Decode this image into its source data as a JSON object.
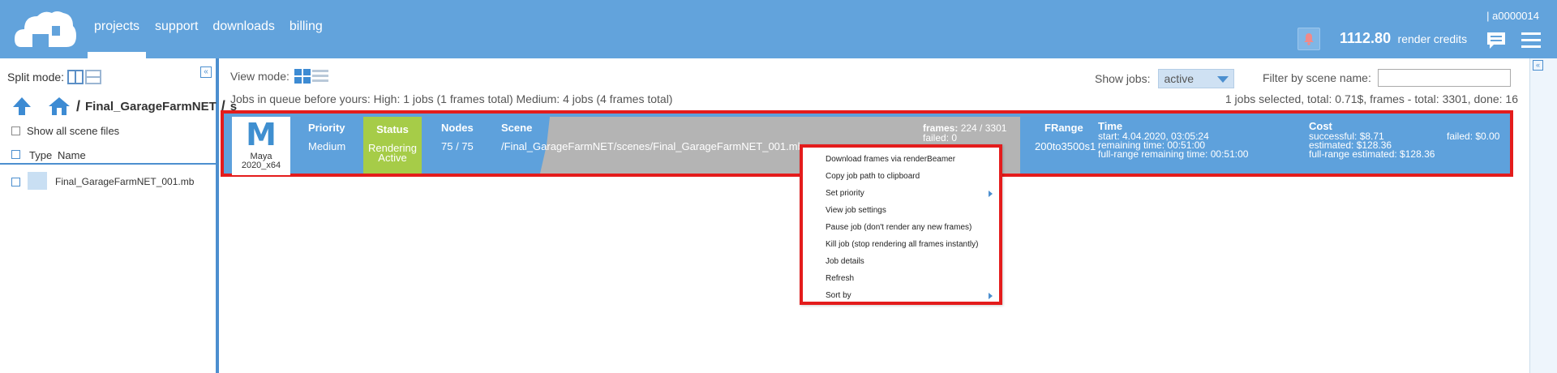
{
  "header": {
    "nav": [
      "projects",
      "support",
      "downloads",
      "billing"
    ],
    "account": "| a0000014",
    "credits_amount": "1112.80",
    "credits_label": "render credits"
  },
  "left": {
    "split_mode": "Split mode:",
    "breadcrumb_folder": "Final_GarageFarmNET",
    "breadcrumb_more": "s",
    "show_all": "Show all scene files",
    "col_type": "Type",
    "col_name": "Name",
    "files": [
      "Final_GarageFarmNET_001.mb"
    ]
  },
  "toolbar": {
    "view_mode": "View mode:",
    "show_jobs": "Show jobs:",
    "show_jobs_value": "active",
    "filter_label": "Filter by scene name:",
    "filter_value": "",
    "queue_info": "Jobs in queue before yours: High: 1 jobs (1 frames total)  Medium: 4 jobs (4 frames total)",
    "summary": "1 jobs selected, total: 0.71$, frames - total: 3301, done: 16"
  },
  "job": {
    "app": "Maya",
    "version": "2020_x64",
    "priority_h": "Priority",
    "priority": "Medium",
    "status_h": "Status",
    "status1": "Rendering",
    "status2": "Active",
    "nodes_h": "Nodes",
    "nodes": "75 / 75",
    "scene_h": "Scene",
    "scene": "/Final_GarageFarmNET/scenes/Final_GarageFarmNET_001.mb",
    "frames_label": "frames:",
    "frames": "224 / 3301",
    "failed": "failed: 0",
    "frange_h": "FRange",
    "frange": "200to3500s1",
    "time_h": "Time",
    "start": "start: 4.04.2020, 03:05:24",
    "remaining": "remaining time: 00:51:00",
    "full_remaining": "full-range remaining time: 00:51:00",
    "cost_h": "Cost",
    "successful": "successful: $8.71",
    "estimated": "estimated: $128.36",
    "full_estimated": "full-range estimated: $128.36",
    "failed_cost": "failed: $0.00"
  },
  "context_menu": [
    "Download frames via renderBeamer",
    "Copy job path to clipboard",
    "Set priority",
    "View job settings",
    "Pause job (don't render any new frames)",
    "Kill job (stop rendering all frames instantly)",
    "Job details",
    "Refresh",
    "Sort by"
  ],
  "colors": {
    "header": "#62a3dc",
    "status": "#a6cc48",
    "highlight": "#e41c1c"
  }
}
